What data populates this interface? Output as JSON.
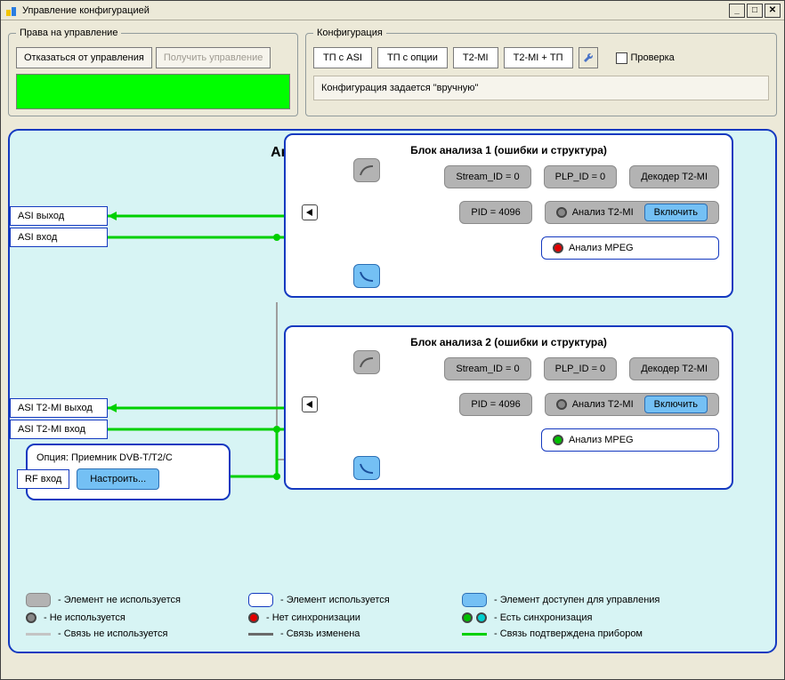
{
  "window": {
    "title": "Управление конфигурацией"
  },
  "rights": {
    "legend": "Права на управление",
    "refuse": "Отказаться от управления",
    "obtain": "Получить управление"
  },
  "config": {
    "legend": "Конфигурация",
    "tabs": [
      "ТП с ASI",
      "ТП с опции",
      "T2-MI",
      "T2-MI + ТП"
    ],
    "check_label": "Проверка",
    "status": "Конфигурация задается \"вручную\""
  },
  "analyzer": {
    "title": "Анализатор транспортного потока",
    "block_titles": [
      "Блок анализа 1 (ошибки и структура)",
      "Блок анализа 2 (ошибки и структура)"
    ],
    "stream_id": "Stream_ID = 0",
    "plp_id": "PLP_ID = 0",
    "decoder": "Декодер T2-MI",
    "pid": "PID = 4096",
    "analyze_t2mi": "Анализ T2-MI",
    "enable": "Включить",
    "analyze_mpeg": "Анализ MPEG",
    "io": {
      "asi_out": "ASI выход",
      "asi_in": "ASI вход",
      "asi_t2mi_out": "ASI T2-MI выход",
      "asi_t2mi_in": "ASI T2-MI вход"
    },
    "option": {
      "title": "Опция: Приемник DVB-T/T2/C",
      "rf_in": "RF вход",
      "configure": "Настроить..."
    },
    "legend": {
      "el_not_used": "- Элемент не используется",
      "el_used": "- Элемент используется",
      "el_managed": "- Элемент доступен для управления",
      "sync_not_used": "- Не используется",
      "sync_no": "- Нет синхронизации",
      "sync_yes": "- Есть синхронизация",
      "link_not_used": "- Связь не используется",
      "link_changed": "- Связь изменена",
      "link_confirmed": "- Связь подтверждена прибором"
    }
  }
}
